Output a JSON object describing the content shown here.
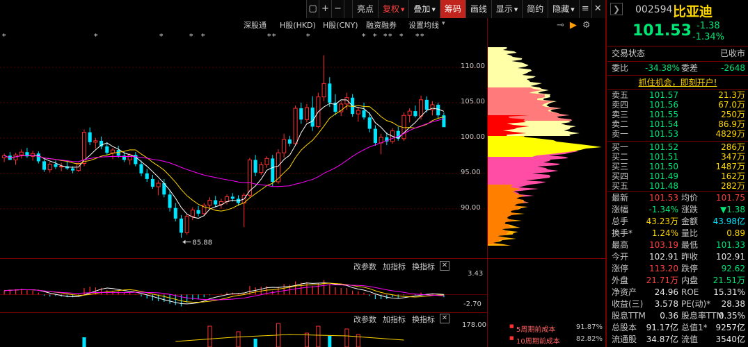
{
  "toolbar": {
    "icons": [
      "square",
      "+",
      "−"
    ],
    "buttons": [
      {
        "label": "亮点",
        "style": "normal",
        "arrow": false
      },
      {
        "label": "复权",
        "style": "red",
        "arrow": true
      },
      {
        "label": "叠加",
        "style": "normal",
        "arrow": true
      },
      {
        "label": "筹码",
        "style": "active",
        "arrow": false
      },
      {
        "label": "画线",
        "style": "normal",
        "arrow": false
      },
      {
        "label": "显示",
        "style": "normal",
        "arrow": true
      },
      {
        "label": "简约",
        "style": "normal",
        "arrow": false
      },
      {
        "label": "隐藏",
        "style": "normal",
        "arrow": true
      }
    ],
    "right_icons": [
      "≡",
      "✕"
    ]
  },
  "info_bar": {
    "items": [
      "深股通",
      "H股(HKD)",
      "H股(CNY)",
      "融资融券",
      "设置均线"
    ],
    "settings_arrow": "▾"
  },
  "chip_controls": [
    "⊸",
    "▶",
    "⚙"
  ],
  "stock": {
    "code": "002594",
    "name": "比亚迪",
    "price": "101.53",
    "change": "-1.38",
    "change_pct": "-1.34%"
  },
  "price_axis": {
    "ticks": [
      "110.00",
      "105.00",
      "100.00",
      "95.00",
      "90.00"
    ],
    "low_marker": "85.88"
  },
  "macd_panel": {
    "buttons": [
      "改参数",
      "加指标",
      "换指标"
    ],
    "close_icon": "✕",
    "ticks": [
      "3.43",
      "-2.70"
    ]
  },
  "vol_panel": {
    "buttons": [
      "改参数",
      "加指标",
      "换指标"
    ],
    "close_icon": "✕",
    "ticks": [
      "178.00"
    ]
  },
  "chip_legend": [
    {
      "label": "5周期前成本",
      "value": "91.87%"
    },
    {
      "label": "10周期前成本",
      "value": "82.82%"
    }
  ],
  "trade_status": {
    "label": "交易状态",
    "value": "已收市"
  },
  "weibi": {
    "label": "委比",
    "value": "-34.38%",
    "label2": "委差",
    "value2": "-2648"
  },
  "promo": "抓住机会，即刻开户!",
  "asks": [
    {
      "label": "卖五",
      "price": "101.57",
      "vol": "21.3万"
    },
    {
      "label": "卖四",
      "price": "101.56",
      "vol": "67.0万"
    },
    {
      "label": "卖三",
      "price": "101.55",
      "vol": "250万"
    },
    {
      "label": "卖二",
      "price": "101.54",
      "vol": "86.9万"
    },
    {
      "label": "卖一",
      "price": "101.53",
      "vol": "4829万"
    }
  ],
  "bids": [
    {
      "label": "买一",
      "price": "101.52",
      "vol": "286万"
    },
    {
      "label": "买二",
      "price": "101.51",
      "vol": "347万"
    },
    {
      "label": "买三",
      "price": "101.50",
      "vol": "1487万"
    },
    {
      "label": "买四",
      "price": "101.49",
      "vol": "162万"
    },
    {
      "label": "买五",
      "price": "101.48",
      "vol": "282万"
    }
  ],
  "quote": [
    {
      "l1": "最新",
      "v1": "101.53",
      "c1": "red",
      "l2": "均价",
      "v2": "101.75",
      "c2": "red"
    },
    {
      "l1": "涨幅",
      "v1": "-1.34%",
      "c1": "green",
      "l2": "涨跌",
      "v2": "▼1.38",
      "c2": "green"
    },
    {
      "l1": "总手",
      "v1": "43.23万",
      "c1": "yellow",
      "l2": "金额",
      "v2": "43.98亿",
      "c2": "cyan"
    },
    {
      "l1": "换手*",
      "v1": "1.24%",
      "c1": "yellow",
      "l2": "量比",
      "v2": "0.89",
      "c2": "yellow"
    },
    {
      "l1": "最高",
      "v1": "103.19",
      "c1": "red",
      "l2": "最低",
      "v2": "101.33",
      "c2": "green"
    },
    {
      "l1": "今开",
      "v1": "102.91",
      "c1": "white",
      "l2": "昨收",
      "v2": "102.91",
      "c2": "white"
    },
    {
      "l1": "涨停",
      "v1": "113.20",
      "c1": "red",
      "l2": "跌停",
      "v2": "92.62",
      "c2": "green"
    },
    {
      "l1": "外盘",
      "v1": "21.71万",
      "c1": "red",
      "l2": "内盘",
      "v2": "21.51万",
      "c2": "green"
    },
    {
      "l1": "净资产",
      "v1": "24.96",
      "c1": "white",
      "l2": "ROE",
      "v2": "15.31%",
      "c2": "white"
    },
    {
      "l1": "收益(三)",
      "v1": "3.578",
      "c1": "white",
      "l2": "PE(动)*",
      "v2": "28.38",
      "c2": "white"
    },
    {
      "l1": "股息TTM",
      "v1": "0.36",
      "c1": "white",
      "l2": "股息率TTM",
      "v2": "0.35%",
      "c2": "white"
    },
    {
      "l1": "总股本",
      "v1": "91.17亿",
      "c1": "white",
      "l2": "总值1*",
      "v2": "9257亿",
      "c2": "white"
    },
    {
      "l1": "流通股",
      "v1": "34.87亿",
      "c1": "white",
      "l2": "流值",
      "v2": "3540亿",
      "c2": "white"
    }
  ],
  "chart_data": {
    "type": "candlestick",
    "price_ylim": [
      83,
      115
    ],
    "candles": [
      [
        97.2,
        97.8,
        96.6,
        97.5
      ],
      [
        97.5,
        98.0,
        97.0,
        96.9
      ],
      [
        96.9,
        97.9,
        96.2,
        97.6
      ],
      [
        97.6,
        98.4,
        97.1,
        98.0
      ],
      [
        98.0,
        98.6,
        97.2,
        97.4
      ],
      [
        97.4,
        98.2,
        96.8,
        97.8
      ],
      [
        97.8,
        98.1,
        96.4,
        96.7
      ],
      [
        96.7,
        97.0,
        95.2,
        95.5
      ],
      [
        95.5,
        96.6,
        95.1,
        96.3
      ],
      [
        96.3,
        96.8,
        95.6,
        95.9
      ],
      [
        95.9,
        96.5,
        95.3,
        96.0
      ],
      [
        96.0,
        96.8,
        95.5,
        95.7
      ],
      [
        95.7,
        96.0,
        95.0,
        95.4
      ],
      [
        95.4,
        96.5,
        95.2,
        96.4
      ],
      [
        96.4,
        101.2,
        96.0,
        100.8
      ],
      [
        100.8,
        101.5,
        99.0,
        99.4
      ],
      [
        99.4,
        100.0,
        98.5,
        99.6
      ],
      [
        99.6,
        100.2,
        98.4,
        98.8
      ],
      [
        98.8,
        99.4,
        97.6,
        97.9
      ],
      [
        97.9,
        98.6,
        97.0,
        98.3
      ],
      [
        98.3,
        98.9,
        97.2,
        97.5
      ],
      [
        97.5,
        98.0,
        96.6,
        96.9
      ],
      [
        96.9,
        97.8,
        96.2,
        97.6
      ],
      [
        97.6,
        98.0,
        96.0,
        96.3
      ],
      [
        96.3,
        96.8,
        94.6,
        95.0
      ],
      [
        95.0,
        95.6,
        93.8,
        94.2
      ],
      [
        94.2,
        94.8,
        92.8,
        93.1
      ],
      [
        93.1,
        94.0,
        91.9,
        93.6
      ],
      [
        93.6,
        94.2,
        91.6,
        92.0
      ],
      [
        92.0,
        92.6,
        89.6,
        90.1
      ],
      [
        90.1,
        90.8,
        88.2,
        88.6
      ],
      [
        88.6,
        89.1,
        85.88,
        86.6
      ],
      [
        86.6,
        89.3,
        86.3,
        88.9
      ],
      [
        88.9,
        90.2,
        88.4,
        89.8
      ],
      [
        89.8,
        90.4,
        88.9,
        89.3
      ],
      [
        89.3,
        90.8,
        89.0,
        90.5
      ],
      [
        90.5,
        91.6,
        89.8,
        91.2
      ],
      [
        91.2,
        91.8,
        90.2,
        90.6
      ],
      [
        90.6,
        91.4,
        90.0,
        91.0
      ],
      [
        91.0,
        92.0,
        90.6,
        91.7
      ],
      [
        91.7,
        92.2,
        91.0,
        91.4
      ],
      [
        91.4,
        91.9,
        90.4,
        90.8
      ],
      [
        90.8,
        92.2,
        87.4,
        91.9
      ],
      [
        91.9,
        97.2,
        91.6,
        96.9
      ],
      [
        96.9,
        97.6,
        94.6,
        95.1
      ],
      [
        95.1,
        96.6,
        94.8,
        96.2
      ],
      [
        96.2,
        97.4,
        95.8,
        97.1
      ],
      [
        97.1,
        97.6,
        93.2,
        93.8
      ],
      [
        93.8,
        98.4,
        93.5,
        97.9
      ],
      [
        97.9,
        100.6,
        97.2,
        99.8
      ],
      [
        99.8,
        100.3,
        98.8,
        99.2
      ],
      [
        99.2,
        104.6,
        99.0,
        104.2
      ],
      [
        104.2,
        105.0,
        102.0,
        102.6
      ],
      [
        102.6,
        104.8,
        102.2,
        104.3
      ],
      [
        104.3,
        105.9,
        101.0,
        101.6
      ],
      [
        101.6,
        106.4,
        101.4,
        105.8
      ],
      [
        105.8,
        111.7,
        105.2,
        107.7
      ],
      [
        107.7,
        108.6,
        104.4,
        105.0
      ],
      [
        105.0,
        106.2,
        103.2,
        103.7
      ],
      [
        103.7,
        105.2,
        103.1,
        104.8
      ],
      [
        104.8,
        106.4,
        104.0,
        105.7
      ],
      [
        105.7,
        106.2,
        103.0,
        103.4
      ],
      [
        103.4,
        104.4,
        102.3,
        103.9
      ],
      [
        103.9,
        105.0,
        102.6,
        102.9
      ],
      [
        102.9,
        103.6,
        100.8,
        101.3
      ],
      [
        101.3,
        101.8,
        98.9,
        99.3
      ],
      [
        99.3,
        100.6,
        97.7,
        100.1
      ],
      [
        100.1,
        100.8,
        99.0,
        99.5
      ],
      [
        99.5,
        101.4,
        99.2,
        101.0
      ],
      [
        101.0,
        101.6,
        99.6,
        99.9
      ],
      [
        99.9,
        103.6,
        99.6,
        103.2
      ],
      [
        103.2,
        104.2,
        102.2,
        103.8
      ],
      [
        103.8,
        104.6,
        102.9,
        103.1
      ],
      [
        103.1,
        106.0,
        102.6,
        105.4
      ],
      [
        105.4,
        105.9,
        103.6,
        104.0
      ],
      [
        104.0,
        105.2,
        103.2,
        104.7
      ],
      [
        104.7,
        105.0,
        102.8,
        103.2
      ],
      [
        103.2,
        103.6,
        101.8,
        101.53
      ]
    ],
    "macd_hist": [
      0.6,
      0.7,
      0.8,
      0.9,
      0.7,
      0.6,
      0.3,
      -0.2,
      -0.3,
      -0.2,
      -0.3,
      -0.4,
      -0.4,
      -0.2,
      1.0,
      1.2,
      1.1,
      1.0,
      0.7,
      0.6,
      0.5,
      0.3,
      0.3,
      0.1,
      -0.3,
      -0.6,
      -0.9,
      -1.0,
      -1.1,
      -1.4,
      -1.6,
      -1.8,
      -1.2,
      -0.8,
      -0.7,
      -0.4,
      -0.1,
      0.0,
      0.1,
      0.3,
      0.3,
      0.2,
      0.3,
      1.3,
      1.1,
      1.2,
      1.3,
      0.6,
      1.2,
      1.6,
      1.5,
      2.0,
      1.8,
      1.9,
      1.3,
      1.7,
      2.2,
      1.6,
      1.1,
      1.0,
      1.0,
      0.6,
      0.5,
      0.3,
      -0.2,
      -0.7,
      -0.7,
      -0.7,
      -0.4,
      -0.5,
      -0.1,
      0.0,
      -0.1,
      0.3,
      0.1,
      0.2,
      -0.1,
      -0.4
    ],
    "macd_ylim": [
      -2.7,
      3.43
    ]
  }
}
